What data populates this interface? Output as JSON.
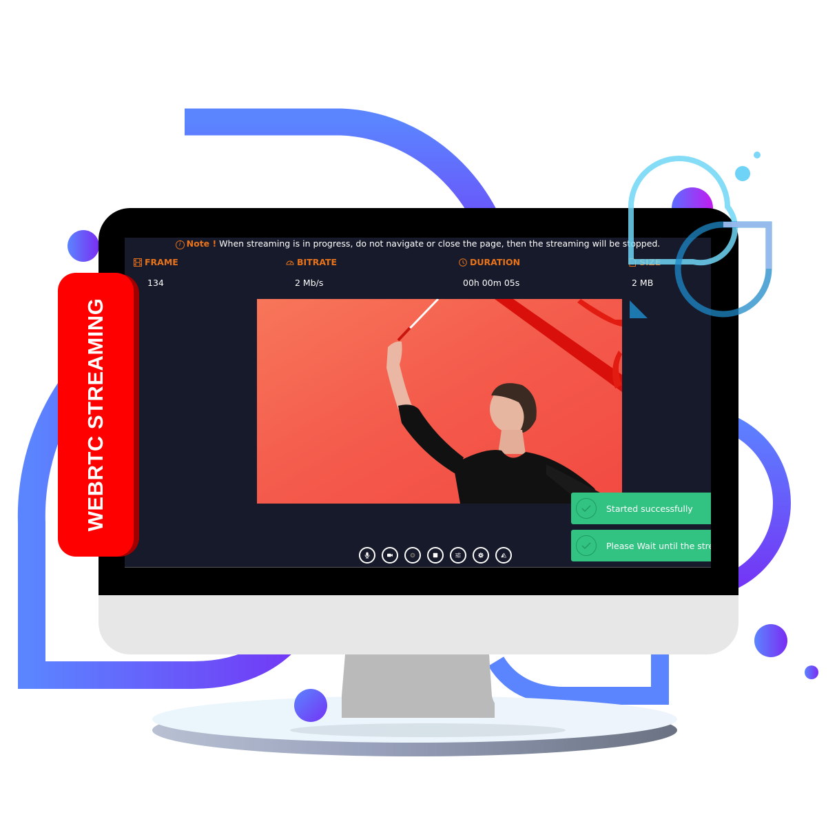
{
  "badge": {
    "label": "WEBRTC STREAMING",
    "color": "#ff0000"
  },
  "note": {
    "icon": "info-icon",
    "prefix": "Note !",
    "message": " When streaming is in progress, do not navigate or close the page, then the streaming will be stopped."
  },
  "stats": [
    {
      "icon": "film-icon",
      "label": "FRAME",
      "value": "134"
    },
    {
      "icon": "gauge-icon",
      "label": "BITRATE",
      "value": "2 Mb/s"
    },
    {
      "icon": "clock-icon",
      "label": "DURATION",
      "value": "00h 00m 05s"
    },
    {
      "icon": "file-icon",
      "label": "SIZE",
      "value": "2 MB"
    }
  ],
  "video": {
    "description": "Woman in black leotard holding a red gymnastics ribbon against a red background"
  },
  "controls": [
    {
      "name": "microphone-button",
      "icon": "microphone-icon"
    },
    {
      "name": "camera-button",
      "icon": "video-camera-icon"
    },
    {
      "name": "record-button",
      "icon": "record-icon"
    },
    {
      "name": "stop-button",
      "icon": "stop-icon"
    },
    {
      "name": "adjustments-button",
      "icon": "sliders-icon"
    },
    {
      "name": "settings-button",
      "icon": "gear-icon"
    },
    {
      "name": "mirror-button",
      "icon": "flip-icon"
    }
  ],
  "toasts": [
    {
      "icon": "check-circle-icon",
      "message": "Started successfully"
    },
    {
      "icon": "check-circle-icon",
      "message": "Please Wait until the stream"
    }
  ],
  "colors": {
    "accent_orange": "#e8731a",
    "screen_bg": "#171a2b",
    "toast_green": "#32c383",
    "shape_blue": "#5b84ff",
    "shape_purple": "#7434f5"
  }
}
